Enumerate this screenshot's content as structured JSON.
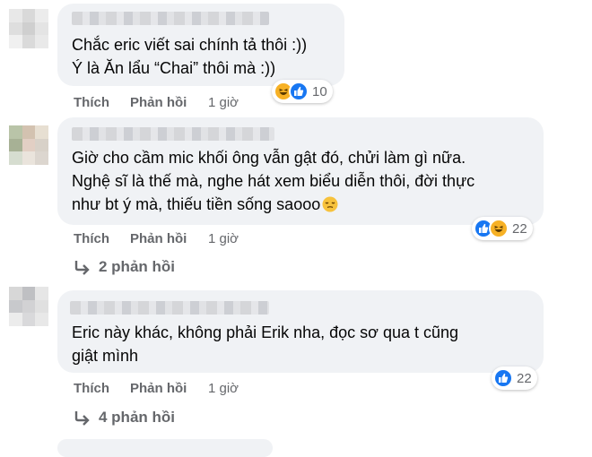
{
  "comments": [
    {
      "lines": [
        "Chắc eric viết sai chính tả thôi :))",
        "Ý là Ăn lẩu “Chai” thôi mà :))"
      ],
      "actions": {
        "like": "Thích",
        "reply": "Phản hồi",
        "time": "1 giờ"
      },
      "reactions": {
        "icons": [
          "haha-icon",
          "like-icon"
        ],
        "count": "10"
      }
    },
    {
      "lines": [
        "Giờ cho cầm mic khối ông vẫn gật đó, chửi làm gì nữa.",
        "Nghệ sĩ là thế mà, nghe hát xem biểu diễn thôi, đời thực",
        "như bt ý mà, thiếu tiền sống saooo"
      ],
      "emoji": "pensive-face-emoji",
      "actions": {
        "like": "Thích",
        "reply": "Phản hồi",
        "time": "1 giờ"
      },
      "reactions": {
        "icons": [
          "like-icon",
          "haha-icon"
        ],
        "count": "22"
      },
      "replies": "2 phản hồi"
    },
    {
      "lines": [
        "Eric này khác, không phải Erik nha, đọc sơ qua t cũng",
        "giật mình"
      ],
      "actions": {
        "like": "Thích",
        "reply": "Phản hồi",
        "time": "1 giờ"
      },
      "reactions": {
        "icons": [
          "like-icon"
        ],
        "count": "22"
      },
      "replies": "4 phản hồi"
    }
  ],
  "colors": {
    "bubble": "#f0f2f5",
    "meta": "#65676b",
    "like": "#1877f2",
    "haha": "#f7b125"
  }
}
